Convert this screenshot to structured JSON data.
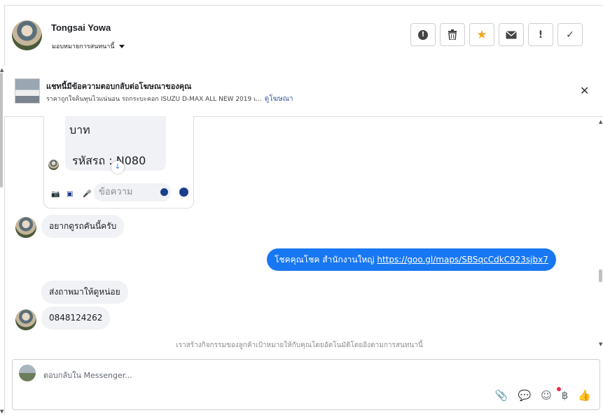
{
  "header": {
    "name": "Tongsai Yowa",
    "assign_label": "มอบหมายการสนทนานี้",
    "actions": [
      {
        "icon": "alert-circle-icon",
        "glyph": "!"
      },
      {
        "icon": "trash-icon",
        "glyph": "🗑"
      },
      {
        "icon": "star-icon",
        "glyph": "★"
      },
      {
        "icon": "envelope-icon",
        "glyph": "✉"
      },
      {
        "icon": "exclamation-icon",
        "glyph": "!"
      },
      {
        "icon": "check-icon",
        "glyph": "✓"
      }
    ]
  },
  "ad": {
    "title": "แชทนี้มีข้อความตอบกลับต่อโฆษณาของคุณ",
    "description": "ราคาถูกใจคินทุนไวแน่นอน รถกระบะคอก ISUZU D-MAX ALL NEW 2019 เ...",
    "link": "ดูโฆษณา",
    "close": "✕"
  },
  "widget": {
    "line1": "บาท",
    "line2": "รหัสรถ : N080",
    "input_placeholder": "ข้อความ"
  },
  "messages": {
    "m1": "อยากดูรถคันนี้ครับ",
    "m2_prefix": "โชคคุณโชค สำนักงานใหญ่ ",
    "m2_link": "https://goo.gl/maps/SBSqcCdkC923sjbx7",
    "m3": "ส่งถาพมาให้ดูหน่อย",
    "m4": "0848124262"
  },
  "notice": "เราสร้างกิจกรรมของลูกค้าเป้าหมายให้กับคุณโดยอัตโนมัติโดยอิงตามการสนทนานี้",
  "composer": {
    "placeholder": "ตอบกลับใน Messenger...",
    "tools": [
      "paperclip-icon",
      "chat-bubble-icon",
      "smile-icon",
      "baht-icon",
      "thumbs-up-icon"
    ]
  },
  "colors": {
    "accent": "#1877f2",
    "star": "#f5a623",
    "bubble": "#f0f2f5"
  }
}
